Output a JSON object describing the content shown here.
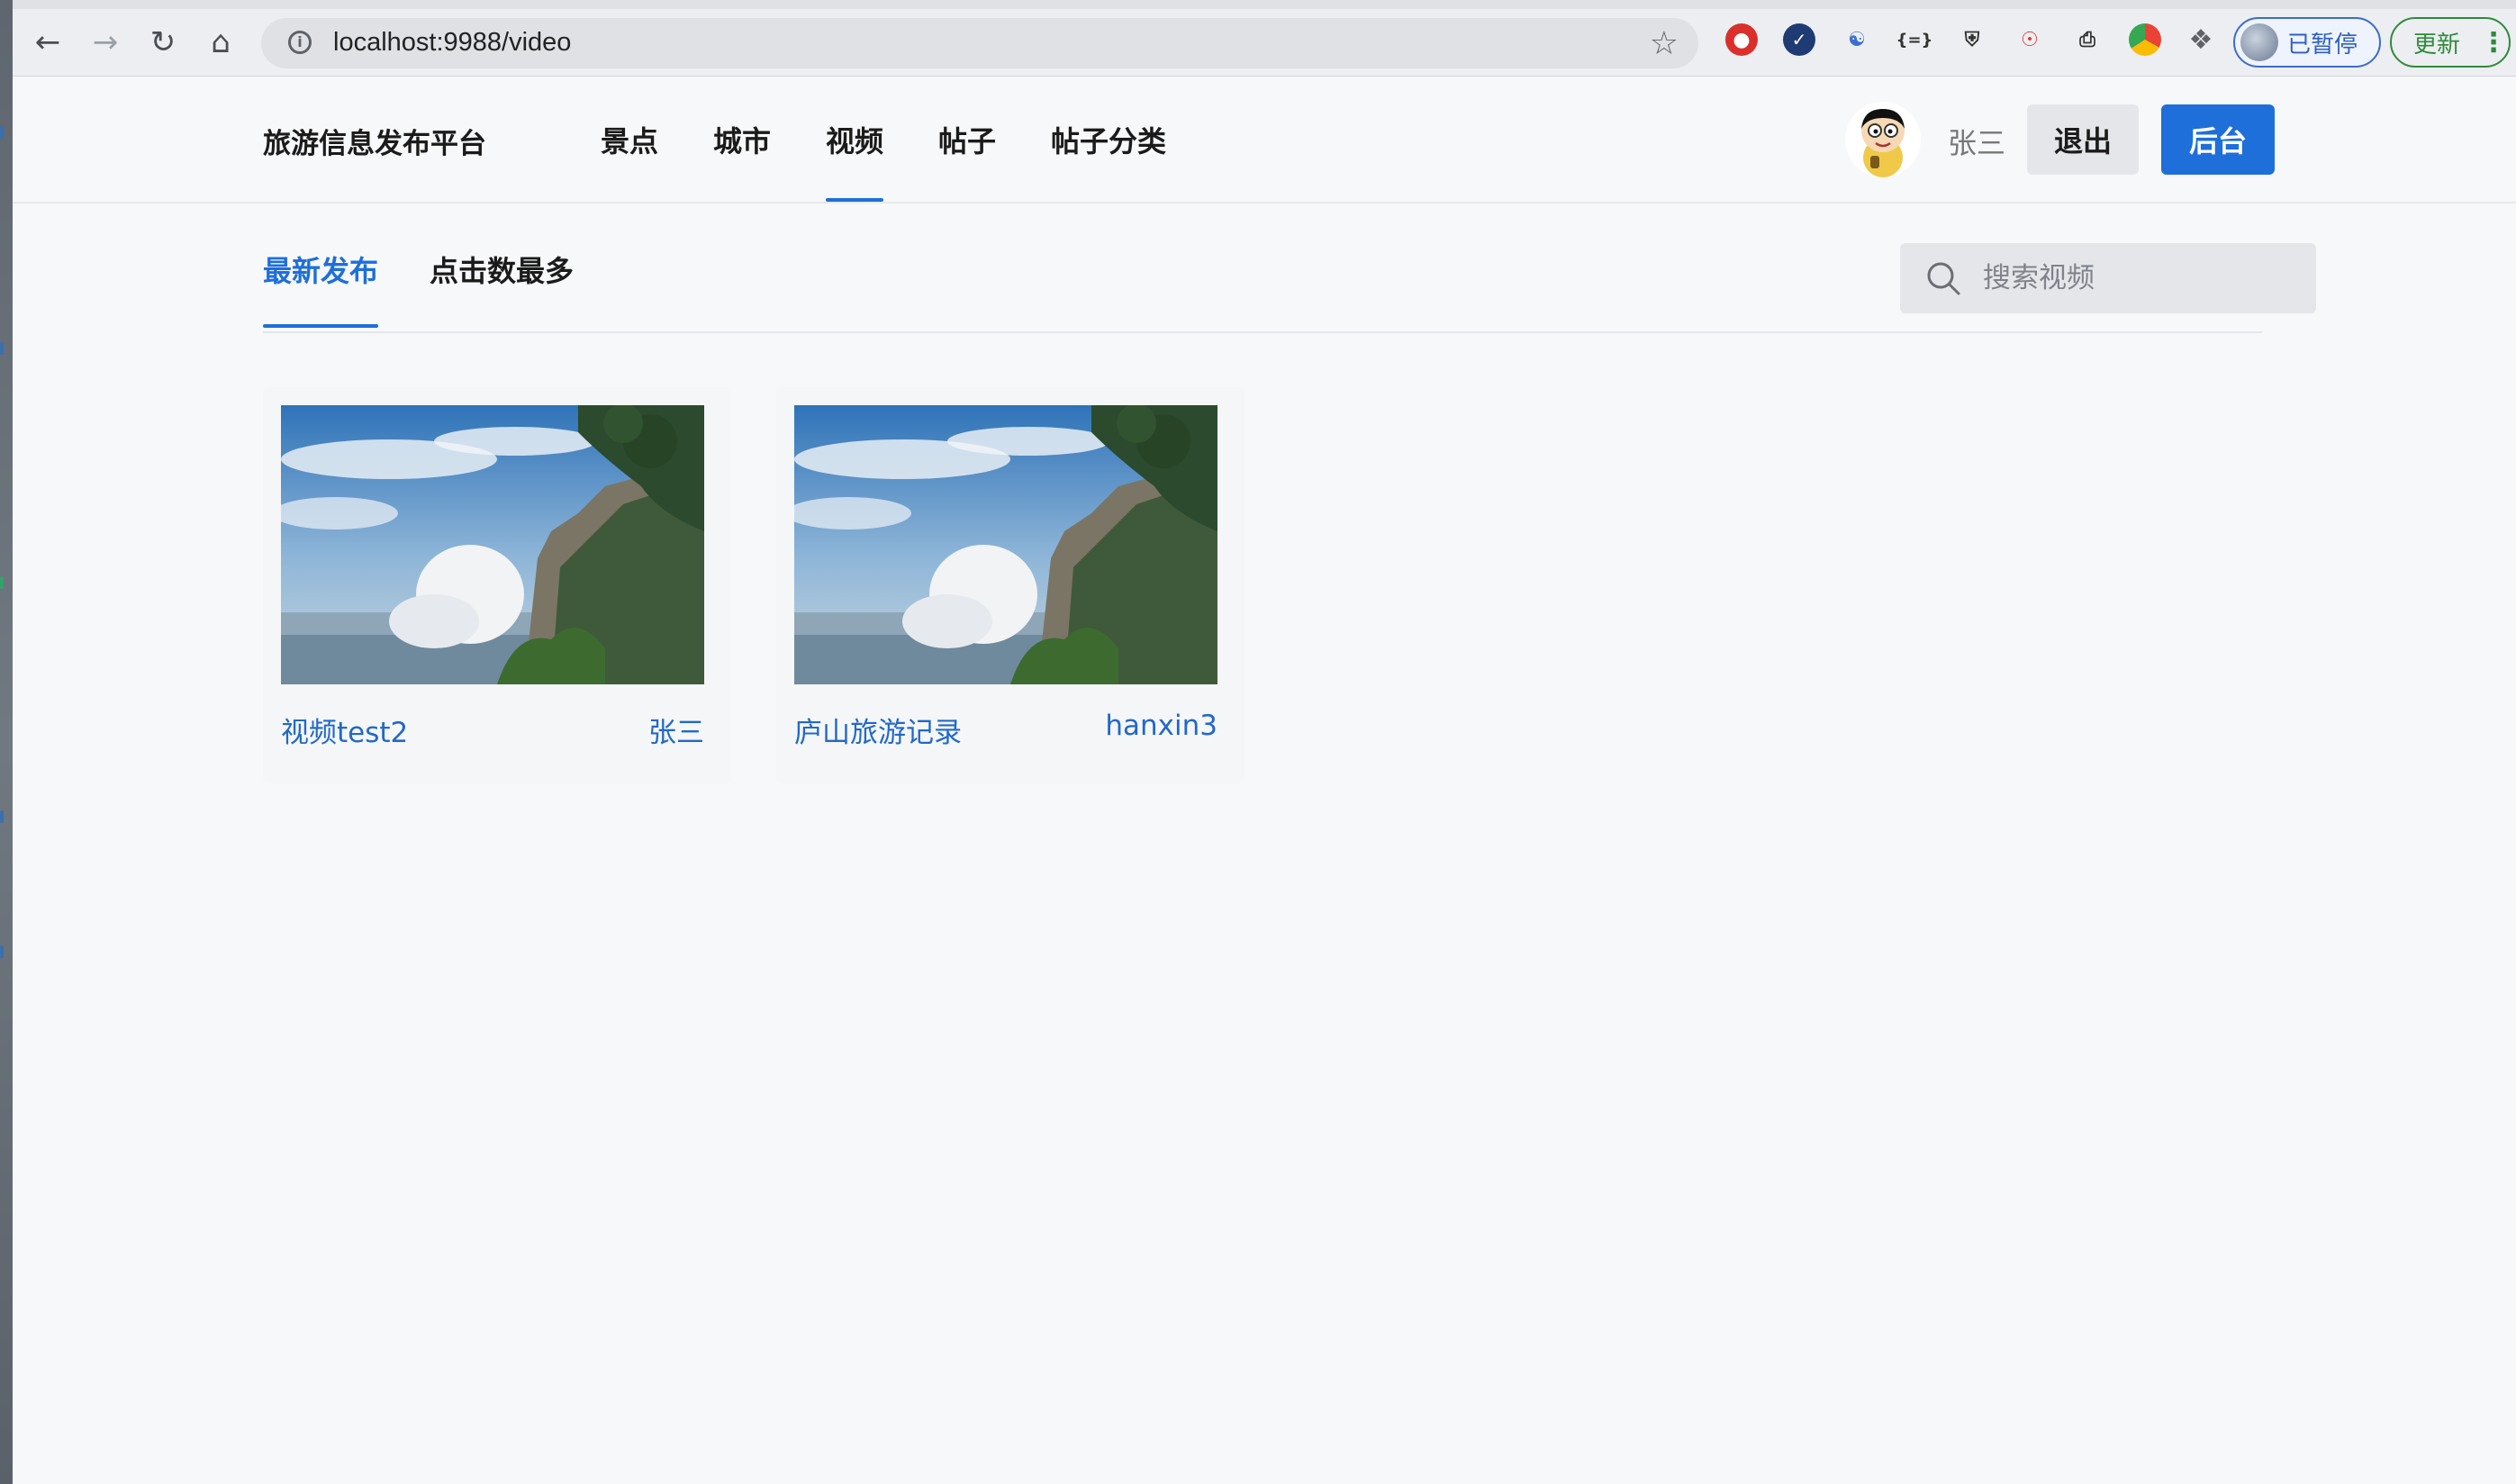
{
  "browser": {
    "url": "localhost:9988/video",
    "profile_label": "已暂停",
    "update_label": "更新",
    "extension_icons": [
      "ublock-icon",
      "check-icon",
      "translate-icon",
      "json-icon",
      "shield-icon",
      "sitemap-icon",
      "clipboard-icon",
      "chrome-icon",
      "puzzle-icon"
    ]
  },
  "header": {
    "brand": "旅游信息发布平台",
    "nav": [
      {
        "label": "景点"
      },
      {
        "label": "城市"
      },
      {
        "label": "视频",
        "active": true
      },
      {
        "label": "帖子"
      },
      {
        "label": "帖子分类"
      }
    ],
    "username": "张三",
    "logout_label": "退出",
    "admin_label": "后台"
  },
  "subnav": {
    "tabs": [
      {
        "label": "最新发布",
        "active": true
      },
      {
        "label": "点击数最多"
      }
    ],
    "search_placeholder": "搜索视频"
  },
  "videos": [
    {
      "title": "视频test2",
      "author": "张三"
    },
    {
      "title": "庐山旅游记录",
      "author": "hanxin3"
    }
  ],
  "colors": {
    "accent": "#1e6fd9",
    "page_bg": "#f7f8fa",
    "link": "#2169c7"
  }
}
